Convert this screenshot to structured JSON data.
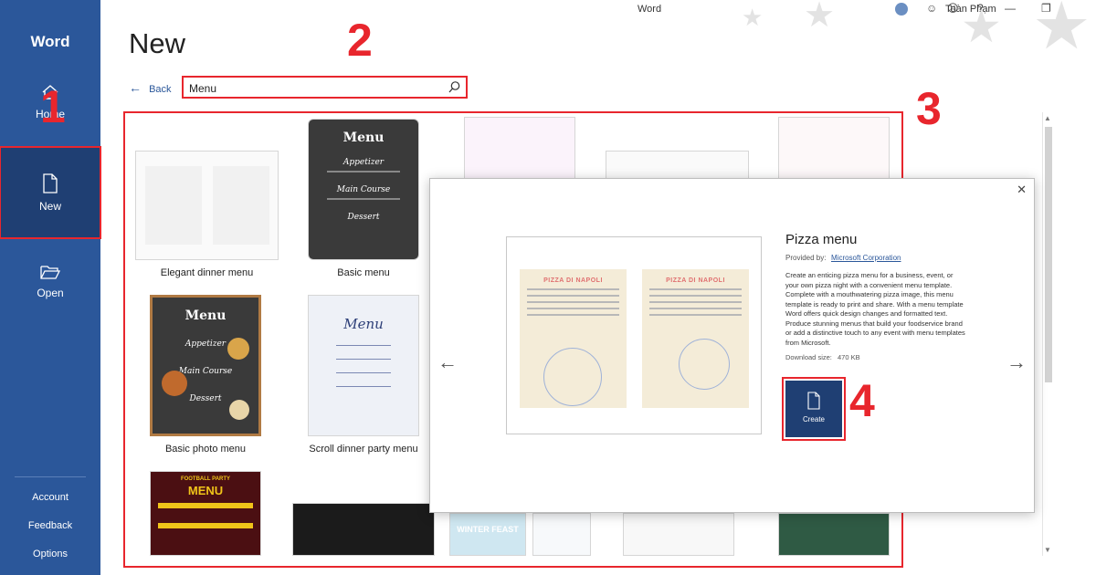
{
  "window": {
    "title": "Word",
    "user": "Toàn Phạm"
  },
  "rail": {
    "app_name": "Word",
    "home": "Home",
    "new": "New",
    "open": "Open",
    "account": "Account",
    "feedback": "Feedback",
    "options": "Options"
  },
  "main": {
    "title": "New",
    "back": "Back",
    "search_value": "Menu"
  },
  "templates": {
    "elegant": "Elegant dinner menu",
    "basic": "Basic menu",
    "basic_photo": "Basic photo menu",
    "scroll": "Scroll dinner party menu",
    "chalk_title": "Menu",
    "chalk_appetizer": "Appetizer",
    "chalk_main": "Main Course",
    "chalk_dessert": "Dessert",
    "football_title": "MENU",
    "football_top": "FOOTBALL PARTY",
    "winter": "WINTER FEAST"
  },
  "dialog": {
    "title": "Pizza menu",
    "provided_by": "Provided by:",
    "provider": "Microsoft Corporation",
    "description": "Create an enticing pizza menu for a business, event, or your own pizza night with a convenient menu template. Complete with a mouthwatering pizza image, this menu template is ready to print and share. With a menu template Word offers quick design changes and formatted text. Produce stunning menus that build your foodservice brand or add a distinctive touch to any event with menu templates from Microsoft.",
    "download_label": "Download size:",
    "download_value": "470 KB",
    "create": "Create",
    "preview_heading": "PIZZA DI NAPOLI"
  },
  "annotations": {
    "n1": "1",
    "n2": "2",
    "n3": "3",
    "n4": "4"
  },
  "colors": {
    "rail": "#2b579a",
    "highlight": "#e8262d",
    "create": "#1f3f73"
  },
  "icons": [
    "home-icon",
    "new-doc-icon",
    "folder-open-icon",
    "search-icon",
    "back-arrow-icon",
    "close-icon",
    "chevron-left-icon",
    "chevron-right-icon"
  ]
}
